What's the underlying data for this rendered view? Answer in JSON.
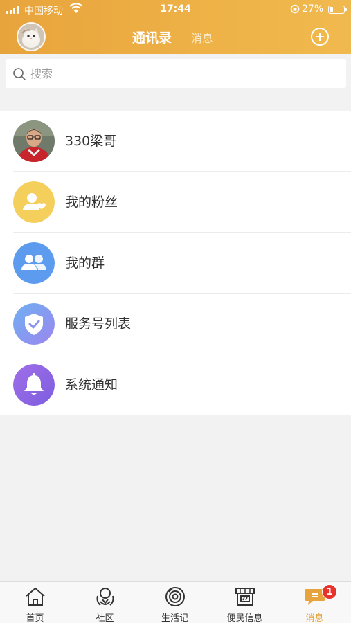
{
  "status_bar": {
    "carrier": "中国移动",
    "time": "17:44",
    "battery": "27%",
    "battery_level": 0.27
  },
  "nav": {
    "tab_contacts": "通讯录",
    "tab_messages": "消息",
    "add_icon": "plus-circle-icon"
  },
  "search": {
    "placeholder": "搜索",
    "value": ""
  },
  "list": [
    {
      "label": "330梁哥",
      "icon": "user-photo-avatar"
    },
    {
      "label": "我的粉丝",
      "icon": "user-heart-icon",
      "color": "#f5cf5b"
    },
    {
      "label": "我的群",
      "icon": "group-icon",
      "color": "#5c9bee"
    },
    {
      "label": "服务号列表",
      "icon": "shield-check-icon",
      "color": "#7f8ff0"
    },
    {
      "label": "系统通知",
      "icon": "bell-icon",
      "color": "#8e63e6"
    }
  ],
  "tabbar": [
    {
      "label": "首页",
      "icon": "home-icon"
    },
    {
      "label": "社区",
      "icon": "community-icon"
    },
    {
      "label": "生活记",
      "icon": "camera-lens-icon"
    },
    {
      "label": "便民信息",
      "icon": "storefront-icon"
    },
    {
      "label": "消息",
      "icon": "chat-bubble-icon",
      "badge": "1",
      "active": true
    }
  ],
  "colors": {
    "brand": "#eeb247",
    "active_tab": "#e8a43c",
    "badge": "#e8322c"
  }
}
